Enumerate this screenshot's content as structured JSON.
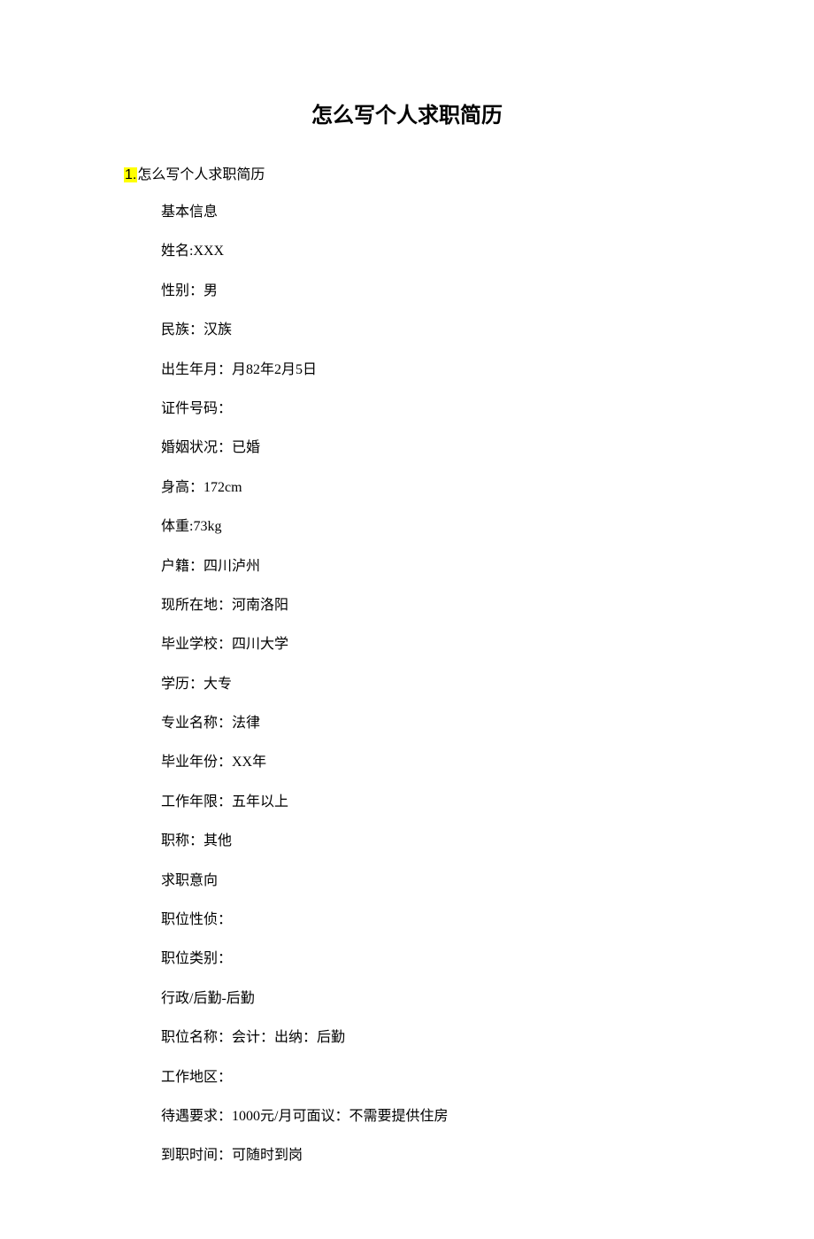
{
  "title": "怎么写个人求职简历",
  "heading_number": "1.",
  "heading_text": "怎么写个人求职简历",
  "lines": [
    "基本信息",
    "姓名:XXX",
    "性别：男",
    "民族：汉族",
    "出生年月：月82年2月5日",
    "证件号码：",
    "婚姻状况：已婚",
    "身高：172cm",
    "体重:73kg",
    "户籍：四川泸州",
    "现所在地：河南洛阳",
    "毕业学校：四川大学",
    "学历：大专",
    "专业名称：法律",
    "毕业年份：XX年",
    "工作年限：五年以上",
    "职称：其他",
    "求职意向",
    "职位性侦：",
    "职位类别：",
    "行政/后勤-后勤",
    "职位名称：会计：出纳：后勤",
    "工作地区：",
    "待遇要求：1000元/月可面议：不需要提供住房",
    "到职时间：可随时到岗"
  ]
}
